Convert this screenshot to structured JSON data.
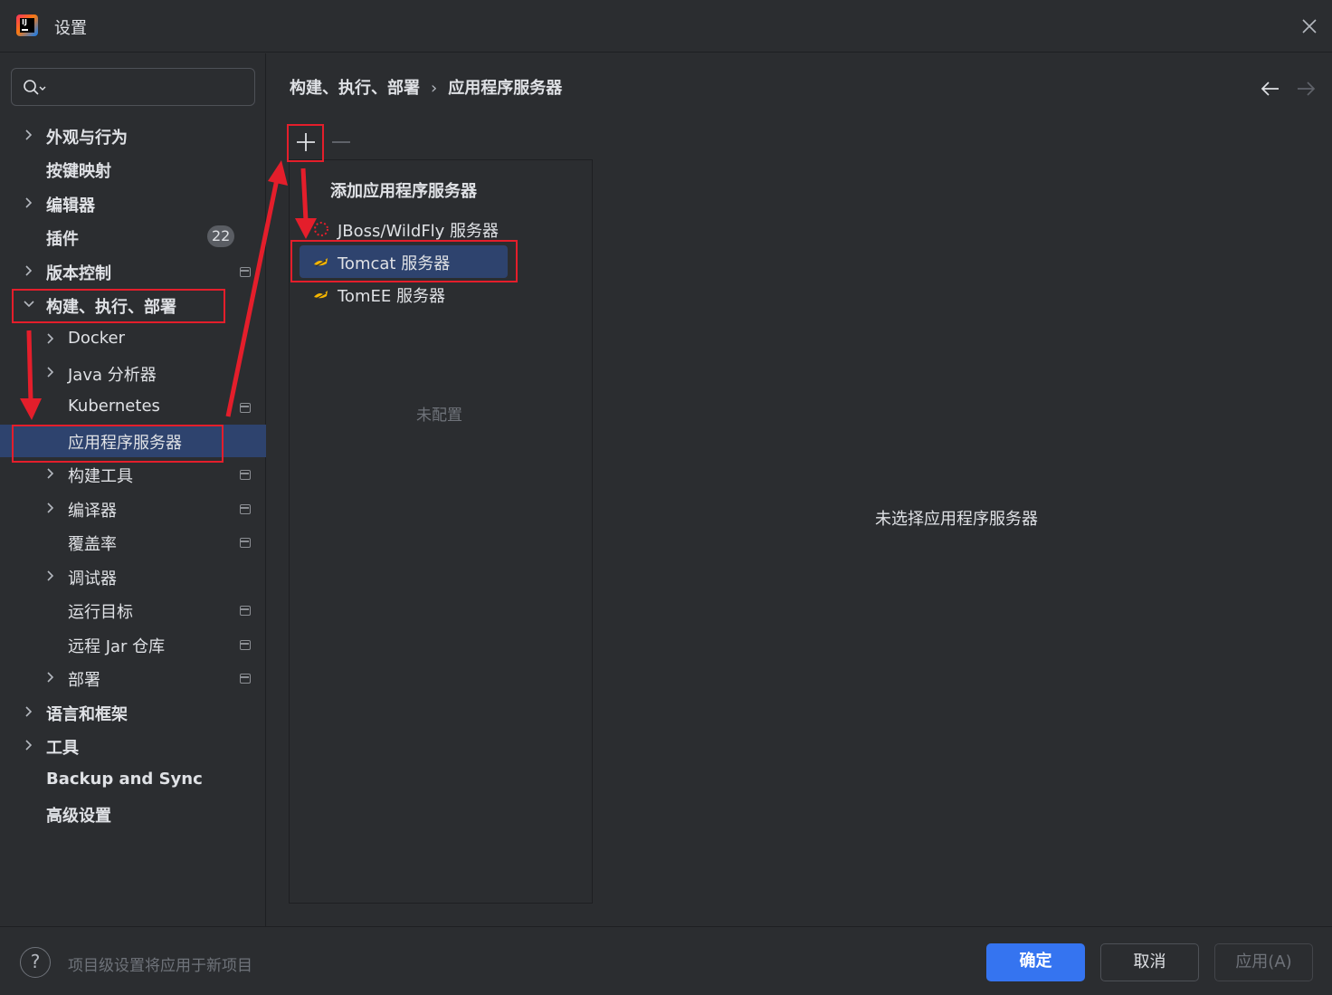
{
  "window": {
    "title": "设置",
    "logo_text": "IJ"
  },
  "search": {
    "placeholder": ""
  },
  "sidebar": {
    "items": [
      {
        "label": "外观与行为",
        "expandable": true
      },
      {
        "label": "按键映射"
      },
      {
        "label": "编辑器",
        "expandable": true
      },
      {
        "label": "插件",
        "badge": "22"
      },
      {
        "label": "版本控制",
        "expandable": true
      },
      {
        "label": "构建、执行、部署",
        "expanded": true
      },
      {
        "label": "Docker",
        "expandable": true
      },
      {
        "label": "Java 分析器",
        "expandable": true
      },
      {
        "label": "Kubernetes"
      },
      {
        "label": "应用程序服务器",
        "selected": true
      },
      {
        "label": "构建工具",
        "expandable": true
      },
      {
        "label": "编译器",
        "expandable": true
      },
      {
        "label": "覆盖率"
      },
      {
        "label": "调试器",
        "expandable": true
      },
      {
        "label": "运行目标"
      },
      {
        "label": "远程 Jar 仓库"
      },
      {
        "label": "部署",
        "expandable": true
      },
      {
        "label": "语言和框架",
        "expandable": true
      },
      {
        "label": "工具",
        "expandable": true
      },
      {
        "label": "Backup and Sync"
      },
      {
        "label": "高级设置"
      }
    ]
  },
  "breadcrumb": {
    "parent": "构建、执行、部署",
    "current": "应用程序服务器"
  },
  "servers": {
    "empty_text": "未配置",
    "no_selection": "未选择应用程序服务器"
  },
  "add_popup": {
    "title": "添加应用程序服务器",
    "items": [
      {
        "label": "JBoss/WildFly 服务器",
        "icon": "jboss-icon"
      },
      {
        "label": "Tomcat 服务器",
        "icon": "tomcat-icon",
        "selected": true
      },
      {
        "label": "TomEE 服务器",
        "icon": "tomee-icon"
      }
    ]
  },
  "footer": {
    "hint": "项目级设置将应用于新项目",
    "ok_label": "确定",
    "cancel_label": "取消",
    "apply_label": "应用(A)"
  },
  "colors": {
    "accent": "#3574f0",
    "selection": "#2e436e",
    "annotation": "#e41e2b"
  }
}
